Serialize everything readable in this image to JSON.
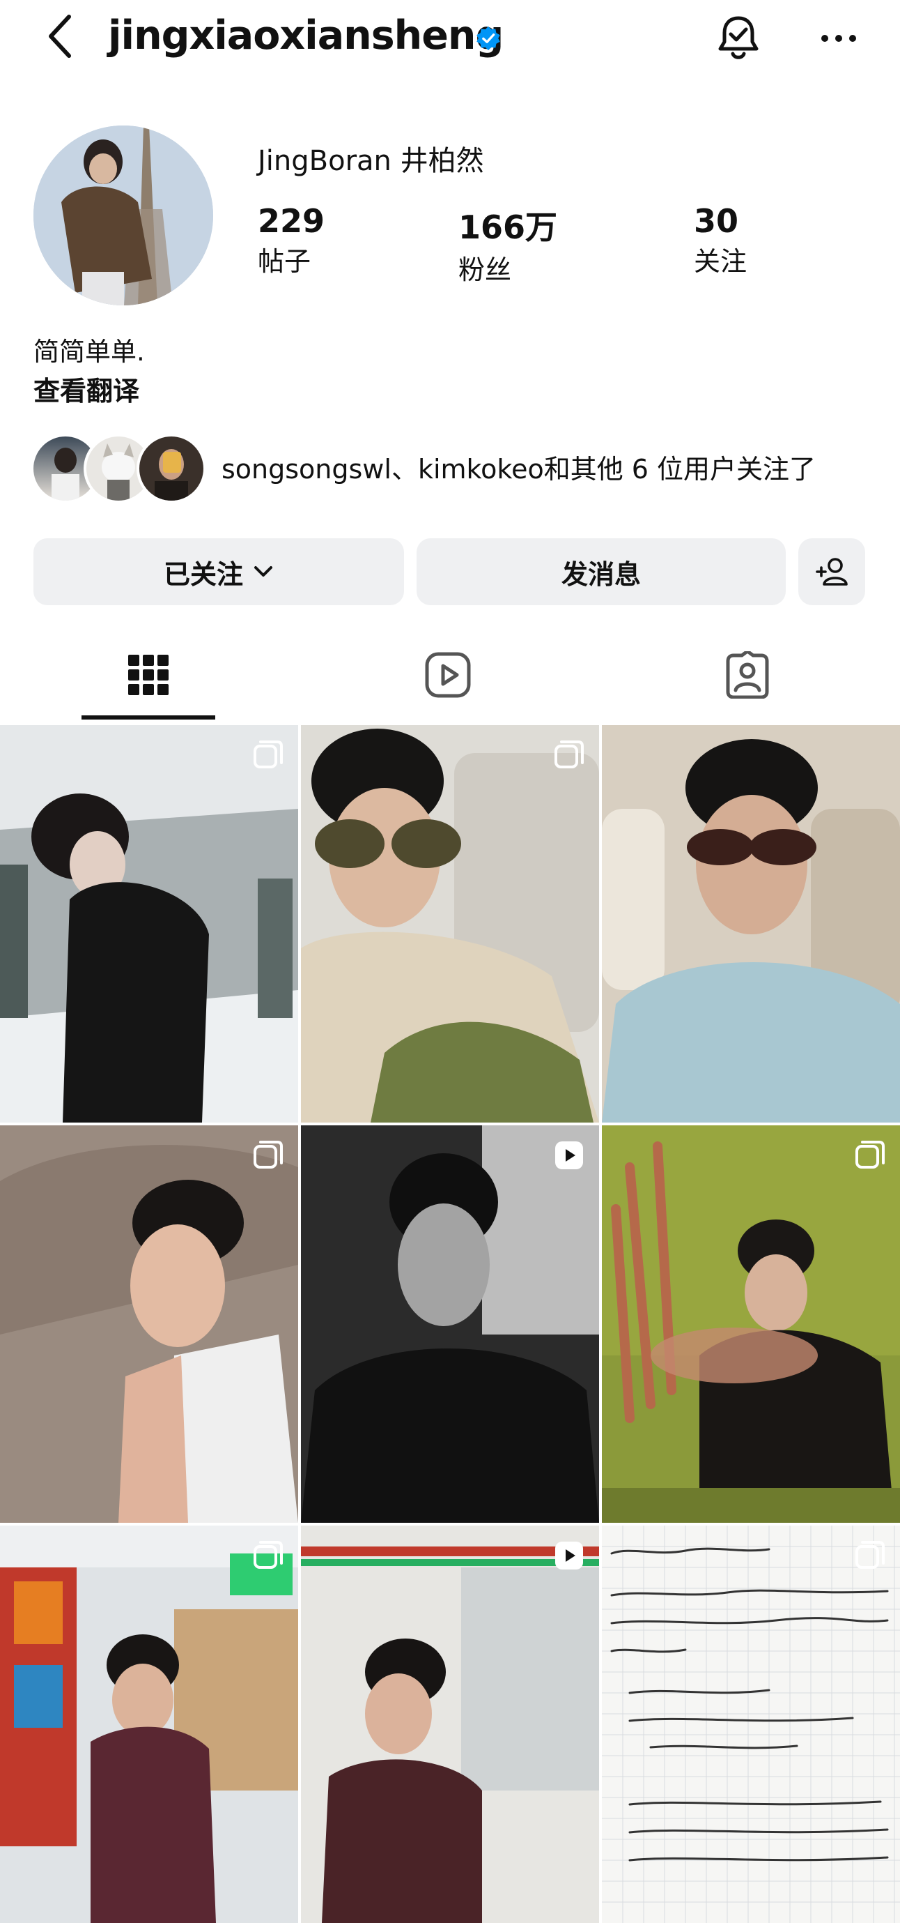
{
  "header": {
    "username": "jingxiaoxiansheng"
  },
  "profile": {
    "display_name": "JingBoran 井柏然",
    "stats": [
      {
        "value": "229",
        "label": "帖子"
      },
      {
        "value": "166万",
        "label": "粉丝"
      },
      {
        "value": "30",
        "label": "关注"
      }
    ],
    "bio": "简简单单.",
    "translate_link": "查看翻译",
    "followed_by": "songsongswl、kimkokeo和其他 6 位用户关注了"
  },
  "actions": {
    "following_label": "已关注",
    "message_label": "发消息"
  },
  "tabs": [
    {
      "name": "posts",
      "icon": "grid-icon",
      "active": true
    },
    {
      "name": "reels",
      "icon": "reels-icon",
      "active": false
    },
    {
      "name": "tagged",
      "icon": "tagged-icon",
      "active": false
    }
  ],
  "grid": [
    {
      "type": "carousel",
      "icon": "carousel-icon"
    },
    {
      "type": "carousel",
      "icon": "carousel-icon"
    },
    {
      "type": "photo"
    },
    {
      "type": "carousel",
      "icon": "carousel-icon"
    },
    {
      "type": "reel",
      "icon": "reel-play-icon"
    },
    {
      "type": "carousel",
      "icon": "carousel-icon"
    },
    {
      "type": "carousel",
      "icon": "carousel-icon"
    },
    {
      "type": "reel",
      "icon": "reel-play-icon"
    },
    {
      "type": "carousel",
      "icon": "carousel-icon"
    }
  ],
  "colors": {
    "verified": "#0095f6",
    "button_bg": "#eff0f2",
    "text": "#111111"
  }
}
